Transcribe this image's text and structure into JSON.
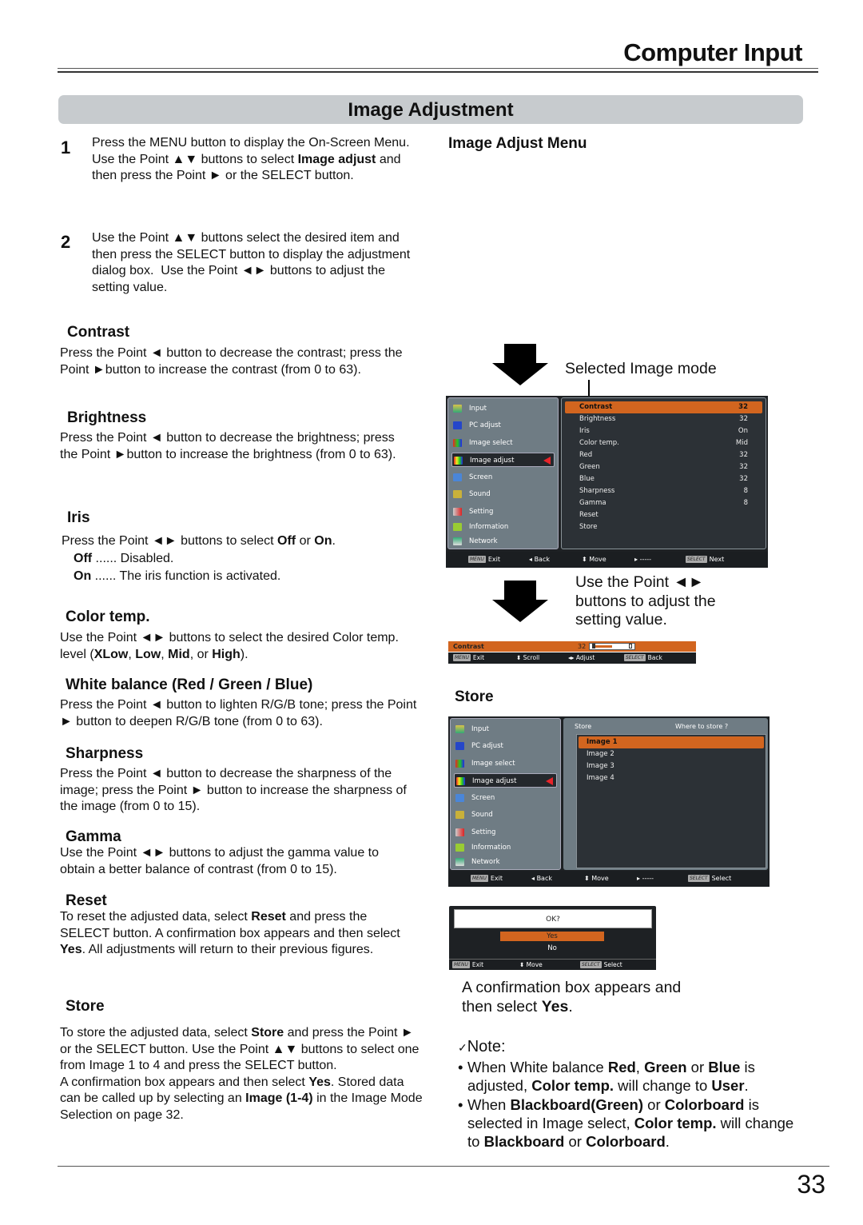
{
  "header": {
    "chapter_title": "Computer Input",
    "section_title": "Image Adjustment"
  },
  "steps": [
    {
      "num": "1",
      "text_html": "Press the MENU button to display the On-Screen Menu.&nbsp; Use the Point ▲▼ buttons to select <b>Image adjust</b> and then press the Point ► or the SELECT button."
    },
    {
      "num": "2",
      "text_html": "Use the Point ▲▼ buttons select the desired item and then press the SELECT button to display the adjustment dialog box.&nbsp; Use the Point ◄► buttons to adjust the setting value."
    }
  ],
  "sections": {
    "contrast": {
      "title": "Contrast",
      "text_html": "Press the Point ◄ button to decrease the contrast; press the Point ►button to increase the contrast (from 0 to 63)."
    },
    "brightness": {
      "title": "Brightness",
      "text_html": "Press the Point ◄ button to decrease the brightness; press&nbsp; the Point ►button to increase the brightness (from 0 to 63)."
    },
    "iris": {
      "title": "Iris",
      "text_html": "Press the Point ◄► buttons to select <b>Off</b> or <b>On</b>.",
      "off_html": "<b>Off</b> ...... Disabled.",
      "on_html": "<b>On</b> ...... The iris function is activated."
    },
    "color_temp": {
      "title": "Color temp.",
      "text_html": "Use the Point ◄► buttons to select the desired Color temp. level (<b>XLow</b>, <b>Low</b>, <b>Mid</b>, or <b>High</b>)."
    },
    "white_balance": {
      "title": "White balance (Red / Green / Blue)",
      "text_html": "Press the Point ◄ button to lighten R/G/B tone; press the Point ► button to deepen R/G/B tone (from 0 to 63)."
    },
    "sharpness": {
      "title": "Sharpness",
      "text_html": "Press the Point ◄ button to decrease the sharpness of the image; press the Point ► button to increase the sharpness of the image (from 0 to 15)."
    },
    "gamma": {
      "title": "Gamma",
      "text_html": "Use the Point ◄► buttons to adjust the gamma value to obtain a better balance of contrast (from 0 to 15)."
    },
    "reset": {
      "title": "Reset",
      "text_html": "To reset the adjusted data, select <b>Reset</b> and press the SELECT button. A confirmation box appears and then select <b>Yes</b>. All adjustments will return to their previous figures."
    },
    "store": {
      "title": "Store",
      "text_html": "To store the adjusted data, select <b>Store</b> and press the Point ► or the SELECT button. Use the Point ▲▼ buttons to select one from Image 1 to 4 and press the SELECT button.<br>A confirmation box appears and then select <b>Yes</b>. Stored data can be called up by selecting an <b>Image (1-4)</b> in the Image Mode Selection on page 32."
    }
  },
  "right": {
    "menu_heading": "Image Adjust Menu",
    "selected_mode_label": "Selected Image mode",
    "adjust_callout": "Use the Point ◄► buttons to adjust the setting value.",
    "store_heading": "Store",
    "confirm_callout_html": "A confirmation box appears and then select <b>Yes</b>."
  },
  "osd_menu": {
    "left_items": [
      {
        "label": "Input",
        "icon": "input-icon"
      },
      {
        "label": "PC adjust",
        "icon": "pc-adjust-icon"
      },
      {
        "label": "Image select",
        "icon": "image-select-icon"
      },
      {
        "label": "Image adjust",
        "icon": "image-adjust-icon",
        "selected": true
      },
      {
        "label": "Screen",
        "icon": "screen-icon"
      },
      {
        "label": "Sound",
        "icon": "sound-icon"
      },
      {
        "label": "Setting",
        "icon": "setting-icon"
      },
      {
        "label": "Information",
        "icon": "information-icon"
      },
      {
        "label": "Network",
        "icon": "network-icon"
      }
    ],
    "adjust_items": [
      {
        "label": "Contrast",
        "value": "32",
        "selected": true
      },
      {
        "label": "Brightness",
        "value": "32"
      },
      {
        "label": "Iris",
        "value": "On"
      },
      {
        "label": "Color temp.",
        "value": "Mid"
      },
      {
        "label": "Red",
        "value": "32"
      },
      {
        "label": "Green",
        "value": "32"
      },
      {
        "label": "Blue",
        "value": "32"
      },
      {
        "label": "Sharpness",
        "value": "8"
      },
      {
        "label": "Gamma",
        "value": "8"
      },
      {
        "label": "Reset",
        "value": ""
      },
      {
        "label": "Store",
        "value": ""
      }
    ],
    "footer": {
      "menu_key": "MENU",
      "exit": "Exit",
      "back": "Back",
      "move": "Move",
      "right": "-----",
      "select_key": "SELECT",
      "next": "Next"
    }
  },
  "osd_adjust_bar": {
    "label": "Contrast",
    "value": "32",
    "fraction": 0.51,
    "footer": {
      "menu_key": "MENU",
      "exit": "Exit",
      "scroll": "Scroll",
      "adjust": "Adjust",
      "select_key": "SELECT",
      "back": "Back"
    }
  },
  "osd_store": {
    "title": "Store",
    "prompt": "Where to store ?",
    "items": [
      {
        "label": "Image 1",
        "selected": true
      },
      {
        "label": "Image 2"
      },
      {
        "label": "Image 3"
      },
      {
        "label": "Image 4"
      }
    ],
    "footer": {
      "menu_key": "MENU",
      "exit": "Exit",
      "back": "Back",
      "move": "Move",
      "right": "-----",
      "select_key": "SELECT",
      "select": "Select"
    }
  },
  "osd_confirm": {
    "question": "OK?",
    "yes": "Yes",
    "no": "No",
    "footer": {
      "menu_key": "MENU",
      "exit": "Exit",
      "move": "Move",
      "select_key": "SELECT",
      "select": "Select"
    }
  },
  "note": {
    "title": "Note:",
    "items_html": [
      "When White balance <b>Red</b>, <b>Green</b> or <b>Blue</b> is adjusted, <b>Color temp.</b> will change to <b>User</b>.",
      "When <b>Blackboard(Green)</b> or <b>Colorboard</b> is selected in Image select, <b>Color temp.</b> will change to <b>Blackboard</b> or <b>Colorboard</b>."
    ]
  },
  "page_number": "33",
  "colors": {
    "accent_orange": "#d2651f",
    "osd_left_bg": "#6f7c84",
    "osd_right_bg": "#2c3136",
    "section_bar": "#c7cbce",
    "pointer_red": "#e8242a"
  }
}
